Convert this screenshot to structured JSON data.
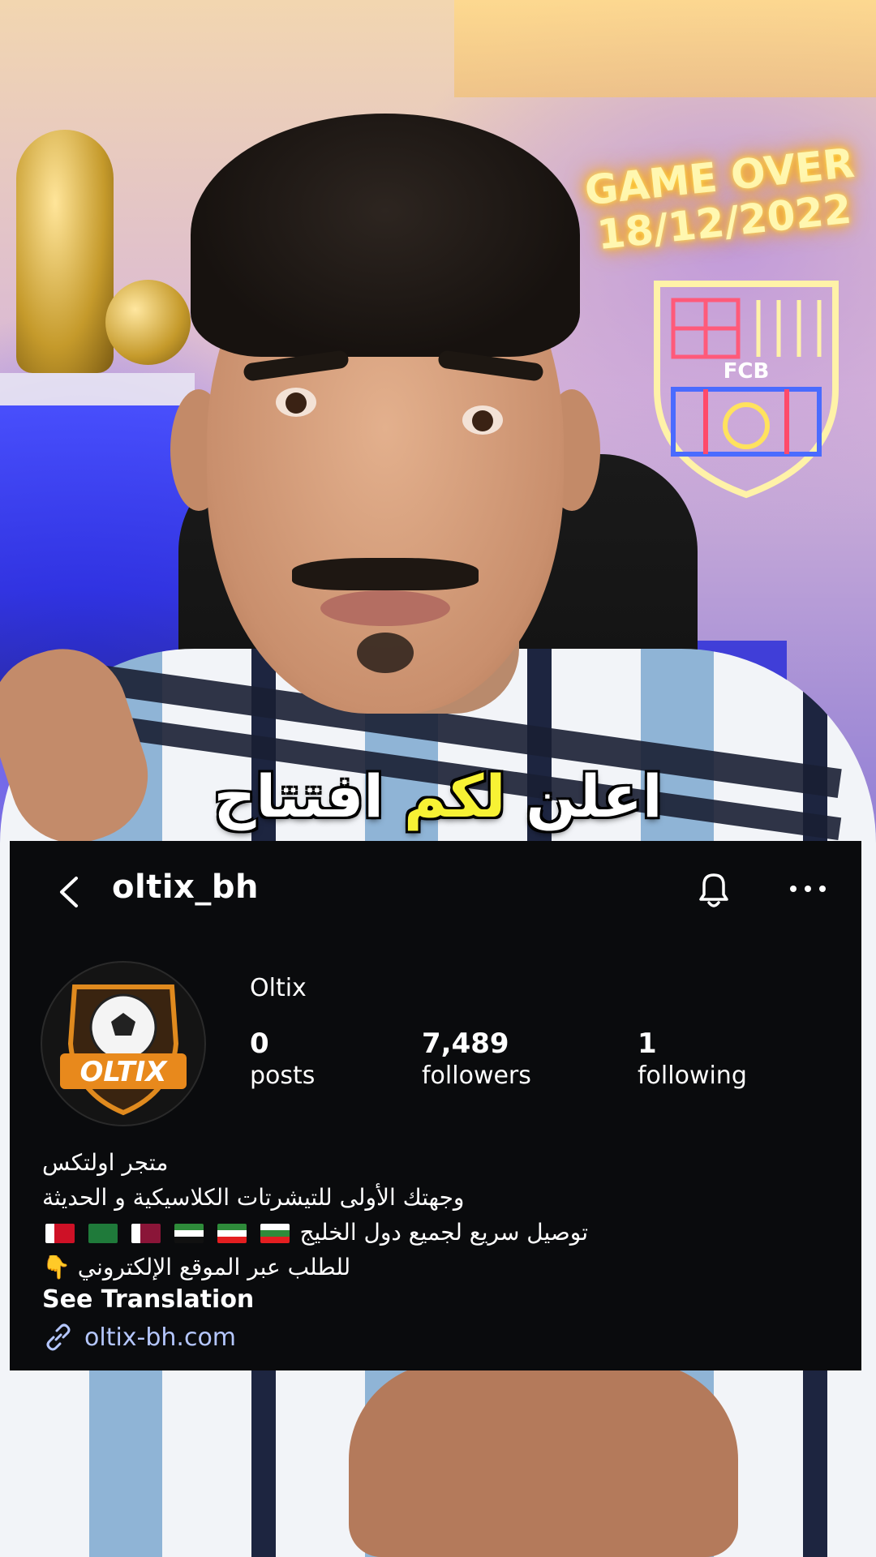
{
  "scene": {
    "neon_line1": "GAME OVER",
    "neon_line2": "18/12/2022",
    "crest_text": "FCB"
  },
  "caption": {
    "part1": "اعلن",
    "highlight": "لكم",
    "part2": "افتتاح"
  },
  "profile": {
    "username": "oltix_bh",
    "display_name": "Oltix",
    "avatar_text": "OLTIX",
    "stats": [
      {
        "value": "0",
        "label": "posts"
      },
      {
        "value": "7,489",
        "label": "followers"
      },
      {
        "value": "1",
        "label": "following"
      }
    ],
    "bio": [
      "متجر اولتكس",
      "وجهتك الأولى للتيشرتات الكلاسيكية و الحديثة",
      "توصيل سريع لجميع دول الخليج",
      "للطلب عبر الموقع الإلكتروني"
    ],
    "pointer_emoji": "👇",
    "see_translation": "See Translation",
    "website": "oltix-bh.com"
  }
}
